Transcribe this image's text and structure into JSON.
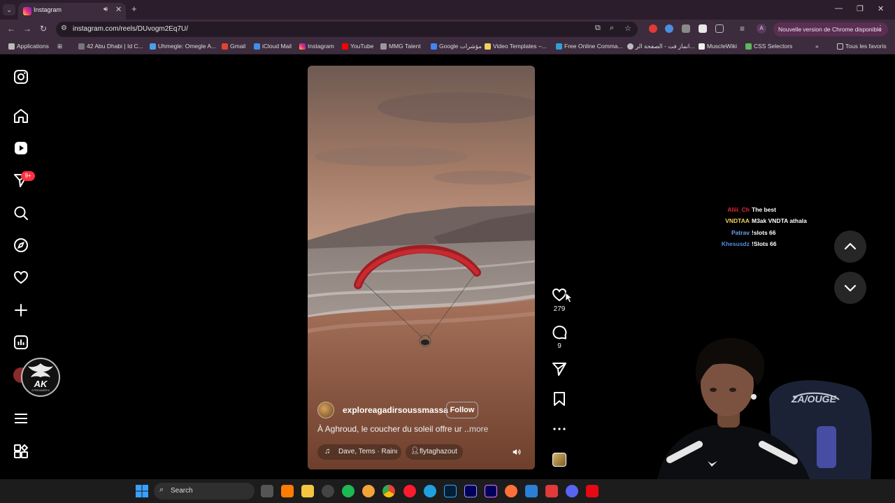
{
  "browser": {
    "tab_title": "Instagram",
    "url": "instagram.com/reels/DUvogm2Eq7U/",
    "update_label": "Nouvelle version de Chrome disponible",
    "profile_initial": "A"
  },
  "bookmarks": {
    "items": [
      "Applications",
      "42 Abu Dhabi | Id C...",
      "Uhmegle: Omegle A...",
      "Gmail",
      "iCloud Mail",
      "Instagram",
      "YouTube",
      "MMG Talent",
      "Google مؤشرات",
      "Video Templates –...",
      "Free Online Comma...",
      "انماز فت - الصفحة الر...",
      "MuscleWiki",
      "CSS Selectors"
    ],
    "all_bookmarks": "Tous les favoris",
    "overflow": "»"
  },
  "sidebar": {
    "notification_badge": "9+",
    "stream_logo_title": "AK",
    "stream_logo_subtitle": "STREAMER'S"
  },
  "reel": {
    "username": "exploreagadirsoussmassa",
    "follow_label": "Follow",
    "caption": "À Aghroud, le coucher du soleil offre ur ...",
    "more_label": "more",
    "audio": "Dave, Tems · Raindance",
    "collaborator": "flytaghazout"
  },
  "actions": {
    "likes": "279",
    "comments": "9"
  },
  "chat": [
    {
      "user": "Aliii_Ch",
      "message": "The best",
      "color": "#e0283c"
    },
    {
      "user": "VNDTAA",
      "message": "M3ak VNDTA athala",
      "color": "#f2d15a"
    },
    {
      "user": "Patrav",
      "message": "!slots 66",
      "color": "#6aa3e8"
    },
    {
      "user": "Khesusdz",
      "message": "!Slots 66",
      "color": "#4f8fe0"
    }
  ],
  "streamer": {
    "chair_text": "ZA/OUGE"
  },
  "taskbar": {
    "search_placeholder": "Search"
  },
  "colors": {
    "chrome_frame": "#2b1d2c",
    "chrome_toolbar": "#3c2c3d",
    "instagram_bg": "#000000",
    "badge": "#ff3040",
    "taskbar": "#1c1c1c"
  }
}
